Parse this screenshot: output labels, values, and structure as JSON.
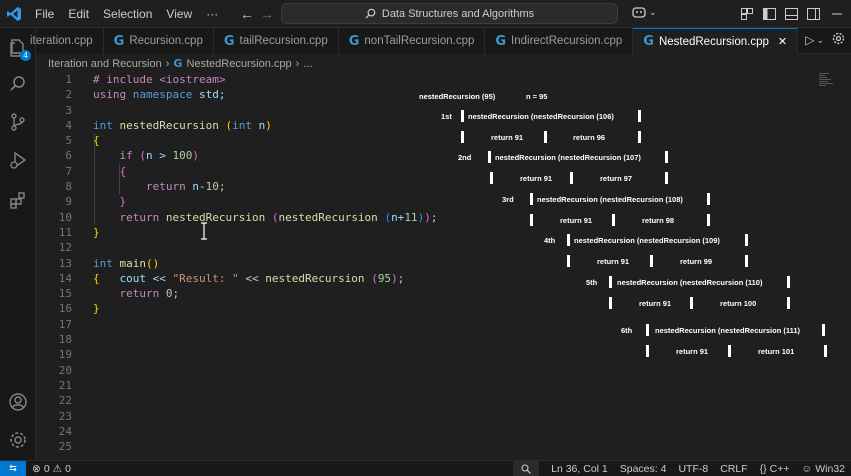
{
  "menu": [
    "File",
    "Edit",
    "Selection",
    "View"
  ],
  "search": {
    "label": "Data Structures and Algorithms"
  },
  "tabs": [
    {
      "label": "iteration.cpp",
      "icon": "cpp-file-icon",
      "active": false
    },
    {
      "label": "Recursion.cpp",
      "icon": "cpp-file-icon",
      "active": false
    },
    {
      "label": "tailRecursion.cpp",
      "icon": "cpp-file-icon",
      "active": false
    },
    {
      "label": "nonTailRecursion.cpp",
      "icon": "cpp-file-icon",
      "active": false
    },
    {
      "label": "IndirectRecursion.cpp",
      "icon": "cpp-file-icon",
      "active": false
    },
    {
      "label": "NestedRecursion.cpp",
      "icon": "cpp-file-icon",
      "active": true
    }
  ],
  "breadcrumb": {
    "folder": "Iteration and Recursion",
    "file": "NestedRecursion.cpp",
    "more": "..."
  },
  "activity": {
    "explorer_badge": "4"
  },
  "line_numbers": [
    "1",
    "2",
    "3",
    "4",
    "5",
    "6",
    "7",
    "8",
    "9",
    "10",
    "11",
    "12",
    "13",
    "14",
    "15",
    "16",
    "17",
    "18",
    "19",
    "20",
    "21",
    "22",
    "23",
    "24",
    "25"
  ],
  "code": {
    "l1": "# include <iostream>",
    "l2a": "using",
    "l2b": "namespace",
    "l2c": "std;",
    "l4a": "int",
    "l4b": "nestedRecursion",
    "l4c": "(",
    "l4d": "int",
    "l4e": "n",
    "l4f": ")",
    "l5": "{",
    "l6a": "if",
    "l6b": "(",
    "l6c": "n > ",
    "l6d": "100",
    "l6e": ")",
    "l7": "{",
    "l8a": "return",
    "l8b": " n-",
    "l8c": "10",
    "l8d": ";",
    "l9": "}",
    "l10a": "return",
    "l10b": "nestedRecursion",
    "l10c": "(",
    "l10d": "nestedRecursion",
    "l10e": "(",
    "l10f": "n+",
    "l10g": "11",
    "l10h": ")",
    "l10i": ")",
    "l10j": ";",
    "l11": "}",
    "l13a": "int",
    "l13b": "main",
    "l13c": "()",
    "l14a": "{",
    "l14b": "cout << ",
    "l14c": "\"Result: \"",
    "l14d": " << ",
    "l14e": "nestedRecursion",
    "l14f": "(",
    "l14g": "95",
    "l14h": ")",
    "l14i": ";",
    "l15a": "return",
    "l15b": "0",
    "l15c": ";",
    "l16": "}"
  },
  "diagram": {
    "root": "nestedRecursion (95)",
    "root_note": "n = 95",
    "levels": [
      {
        "label": "1st",
        "call": "nestedRecursion (nestedRecursion (106)",
        "ret_a": "return 91",
        "ret_b": "return 96"
      },
      {
        "label": "2nd",
        "call": "nestedRecursion (nestedRecursion (107)",
        "ret_a": "return 91",
        "ret_b": "return 97"
      },
      {
        "label": "3rd",
        "call": "nestedRecursion (nestedRecursion (108)",
        "ret_a": "return 91",
        "ret_b": "return 98"
      },
      {
        "label": "4th",
        "call": "nestedRecursion (nestedRecursion (109)",
        "ret_a": "return 91",
        "ret_b": "return 99"
      },
      {
        "label": "5th",
        "call": "nestedRecursion (nestedRecursion (110)",
        "ret_a": "return 91",
        "ret_b": "return 100"
      },
      {
        "label": "6th",
        "call": "nestedRecursion (nestedRecursion (111)",
        "ret_a": "return 91",
        "ret_b": "return 101"
      }
    ]
  },
  "status": {
    "errors": "0",
    "warnings": "0",
    "position": "Ln 36, Col 1",
    "spaces": "Spaces: 4",
    "encoding": "UTF-8",
    "eol": "CRLF",
    "language": "C++",
    "platform": "Win32"
  },
  "colors": {
    "accent": "#0078d4",
    "background": "#1f1f1f"
  }
}
